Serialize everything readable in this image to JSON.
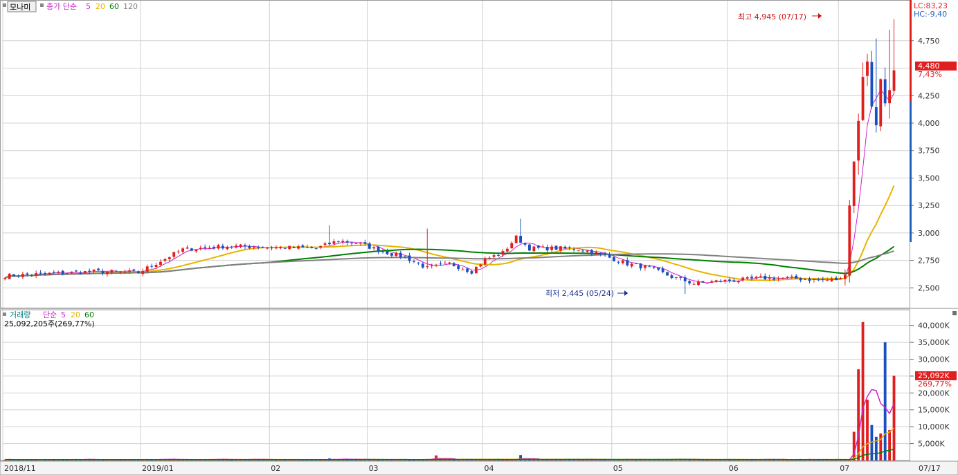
{
  "price_header": {
    "name": "모나미",
    "ma_label": "종가 단순",
    "ma_periods": [
      "5",
      "20",
      "60",
      "120"
    ],
    "ma_colors": [
      "#cc22cc",
      "#e8b400",
      "#008000",
      "#808080"
    ]
  },
  "volume_header": {
    "label": "거래량",
    "ma_label": "단순",
    "ma_periods": [
      "5",
      "20",
      "60"
    ],
    "current": "25,092,205주(269,77%)"
  },
  "corner": {
    "lc": "LC:83,23",
    "hc": "HC:-9,40"
  },
  "price_badges": {
    "current": "4,480",
    "change": "7,43%"
  },
  "volume_badges": {
    "current": "25,092K",
    "change": "269,77%"
  },
  "annotations": {
    "high": "최고 4,945 (07/17)",
    "low": "최저 2,445 (05/24)"
  },
  "price_axis": {
    "ticks": [
      "4,750",
      "4,250",
      "4,000",
      "3,750",
      "3,500",
      "3,250",
      "3,000",
      "2,750",
      "2,500"
    ],
    "values": [
      4750,
      4250,
      4000,
      3750,
      3500,
      3250,
      3000,
      2750,
      2500
    ],
    "range": [
      2320,
      5120
    ]
  },
  "volume_axis": {
    "ticks": [
      "40,000K",
      "35,000K",
      "30,000K",
      "25,000K",
      "20,000K",
      "15,000K",
      "10,000K",
      "5,000K"
    ],
    "values": [
      40000,
      35000,
      30000,
      25000,
      20000,
      15000,
      10000,
      5000
    ],
    "range": [
      0,
      43000
    ]
  },
  "x_axis": {
    "labels": [
      "2018/11",
      "2019/01",
      "02",
      "03",
      "04",
      "05",
      "06",
      "07"
    ],
    "label_index": [
      0,
      31,
      60,
      82,
      108,
      137,
      163,
      188
    ],
    "current_date": "07/17"
  },
  "colors": {
    "up": "#e02020",
    "down": "#1a4fbf",
    "grid": "#d0d0d0",
    "axis_text": "#333333"
  },
  "chart_data": [
    {
      "type": "candlestick",
      "title": "모나미",
      "n_days": 204,
      "close_anchors": [
        [
          0,
          2610
        ],
        [
          10,
          2630
        ],
        [
          20,
          2650
        ],
        [
          30,
          2640
        ],
        [
          40,
          2850
        ],
        [
          50,
          2880
        ],
        [
          60,
          2870
        ],
        [
          70,
          2860
        ],
        [
          75,
          2930
        ],
        [
          80,
          2900
        ],
        [
          85,
          2830
        ],
        [
          90,
          2780
        ],
        [
          95,
          2680
        ],
        [
          100,
          2720
        ],
        [
          105,
          2650
        ],
        [
          108,
          2760
        ],
        [
          112,
          2820
        ],
        [
          115,
          2960
        ],
        [
          118,
          2860
        ],
        [
          125,
          2860
        ],
        [
          130,
          2850
        ],
        [
          135,
          2790
        ],
        [
          140,
          2720
        ],
        [
          145,
          2680
        ],
        [
          150,
          2600
        ],
        [
          155,
          2540
        ],
        [
          160,
          2560
        ],
        [
          165,
          2570
        ],
        [
          170,
          2590
        ],
        [
          175,
          2590
        ],
        [
          180,
          2580
        ],
        [
          185,
          2570
        ],
        [
          188,
          2580
        ],
        [
          189,
          2620
        ],
        [
          190,
          3250
        ],
        [
          191,
          3650
        ],
        [
          192,
          4020
        ],
        [
          193,
          4420
        ],
        [
          194,
          4560
        ],
        [
          195,
          4150
        ],
        [
          196,
          3980
        ],
        [
          197,
          4400
        ],
        [
          198,
          4180
        ],
        [
          199,
          4300
        ],
        [
          200,
          4480
        ]
      ],
      "high": {
        "value": 4945,
        "date": "07/17"
      },
      "low": {
        "value": 2445,
        "date": "05/24"
      },
      "last_close": 4480,
      "change_pct": 7.43,
      "moving_averages": [
        5,
        20,
        60,
        120
      ]
    },
    {
      "type": "bar",
      "title": "거래량",
      "unit": "K",
      "recent_values": [
        8500,
        27000,
        41000,
        18000,
        10500,
        7000,
        8000,
        35000,
        9000,
        25092
      ],
      "moving_averages": [
        5,
        20,
        60
      ],
      "last_value": 25092,
      "change_pct": 269.77
    }
  ]
}
